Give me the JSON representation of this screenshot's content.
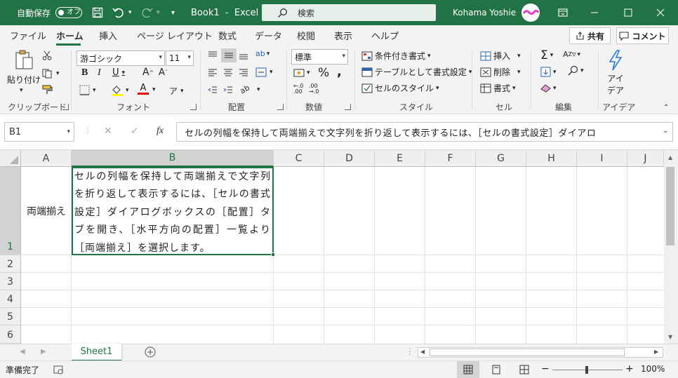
{
  "title_bar": {
    "autosave_label": "自動保存",
    "autosave_state": "オフ",
    "doc_title": "Book1",
    "separator": "-",
    "app_name": "Excel",
    "search_placeholder": "検索",
    "user_name": "Kohama Yoshie"
  },
  "menu_tabs": [
    {
      "label": "ファイル"
    },
    {
      "label": "ホーム"
    },
    {
      "label": "挿入"
    },
    {
      "label": "ページ レイアウト"
    },
    {
      "label": "数式"
    },
    {
      "label": "データ"
    },
    {
      "label": "校閲"
    },
    {
      "label": "表示"
    },
    {
      "label": "ヘルプ"
    }
  ],
  "share_label": "共有",
  "comment_label": "コメント",
  "ribbon": {
    "clipboard": {
      "paste_label": "貼り付け",
      "group_label": "クリップボード"
    },
    "font": {
      "font_name": "游ゴシック",
      "font_size": "11",
      "group_label": "フォント"
    },
    "alignment": {
      "group_label": "配置"
    },
    "number": {
      "format": "標準",
      "group_label": "数値"
    },
    "styles": {
      "conditional_label": "条件付き書式",
      "table_label": "テーブルとして書式設定",
      "cell_styles_label": "セルのスタイル",
      "group_label": "スタイル"
    },
    "cells": {
      "insert_label": "挿入",
      "delete_label": "削除",
      "format_label": "書式",
      "group_label": "セル"
    },
    "editing": {
      "group_label": "編集"
    },
    "ideas": {
      "label_line1": "アイ",
      "label_line2": "デア",
      "group_label": "アイデア"
    }
  },
  "formula_bar": {
    "name_box": "B1",
    "fx_label": "fx",
    "content": "セルの列幅を保持して両端揃えで文字列を折り返して表示するには、［セルの書式設定］ダイアロ"
  },
  "columns": [
    "A",
    "B",
    "C",
    "D",
    "E",
    "F",
    "G",
    "H",
    "I",
    "J"
  ],
  "rows": [
    "1",
    "2",
    "3",
    "4",
    "5",
    "6"
  ],
  "cells": {
    "A1": "両端揃え",
    "B1": "セルの列幅を保持して両端揃えで文字列を折り返して表示するには、［セルの書式設定］ダイアログボックスの［配置］タブを開き、［水平方向の配置］一覧より［両端揃え］を選択します。"
  },
  "sheet_tab": "Sheet1",
  "status": {
    "ready": "準備完了",
    "zoom": "100%"
  },
  "colors": {
    "accent": "#217346"
  }
}
